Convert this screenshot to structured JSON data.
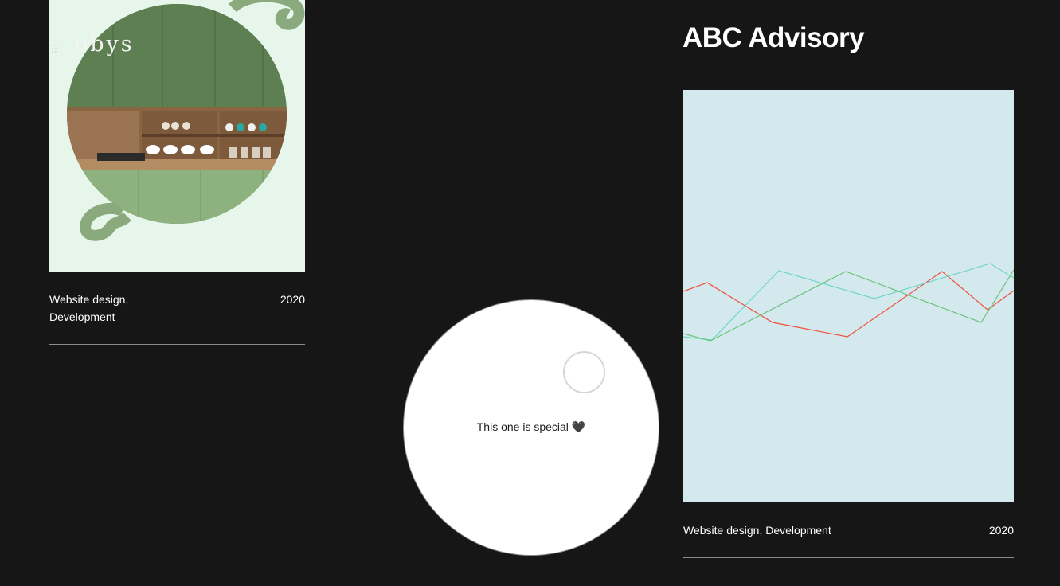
{
  "brand": {
    "logo_text": "obys"
  },
  "projects": [
    {
      "services": "Website design, Development",
      "year": "2020"
    },
    {
      "title": "ABC Advisory",
      "services": "Website design, Development",
      "year": "2020"
    }
  ],
  "cursor": {
    "label": "This one is special 🖤"
  },
  "colors": {
    "background": "#161616",
    "card_left_bg": "#e7f6ea",
    "card_right_bg": "#d4e9ed",
    "line_red": "#f0503c",
    "line_teal": "#6fd6c6",
    "line_green": "#6cc27a"
  }
}
